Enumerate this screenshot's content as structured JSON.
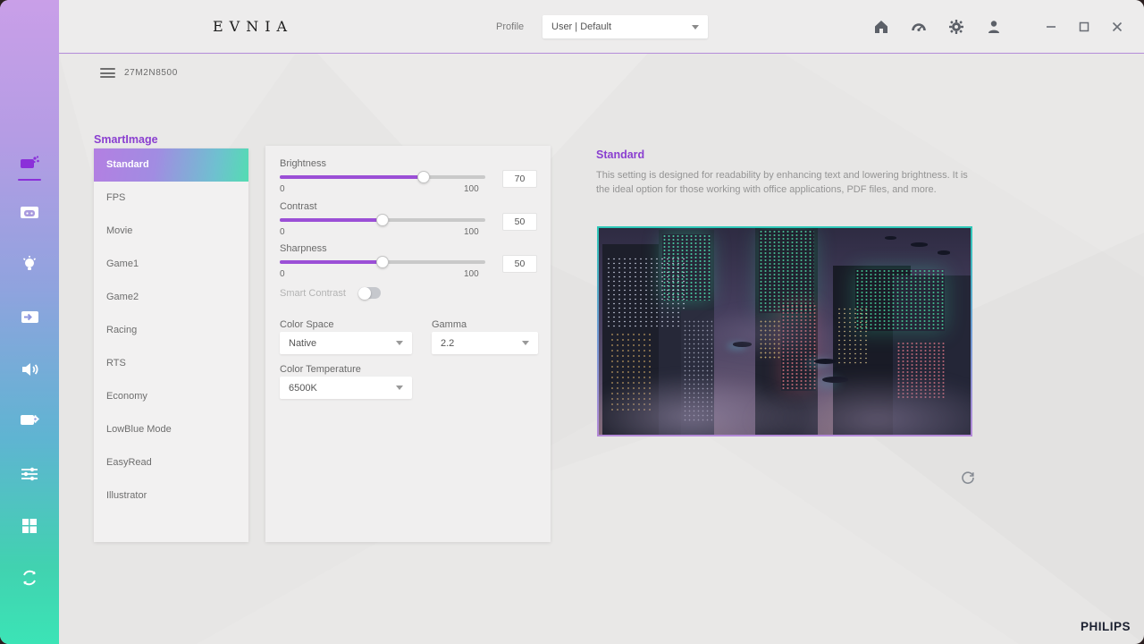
{
  "brand": {
    "logo": "EVNIA",
    "philips": "PHILIPS"
  },
  "header": {
    "profile_label": "Profile",
    "profile_value": "User | Default",
    "icons": [
      "home-icon",
      "dashboard-icon",
      "settings-icon",
      "user-icon"
    ],
    "window_controls": [
      "minimize-icon",
      "maximize-icon",
      "close-icon"
    ]
  },
  "monitor": {
    "name": "27M2N8500"
  },
  "sidebar": {
    "icons": [
      "smartimage-icon",
      "game-mode-icon",
      "lighting-icon",
      "input-source-icon",
      "audio-icon",
      "system-settings-icon",
      "adjustments-icon",
      "layout-icon",
      "sync-icon"
    ],
    "active": "smartimage-icon"
  },
  "smartimage": {
    "title": "SmartImage",
    "selected": "Standard",
    "modes": [
      "Standard",
      "FPS",
      "Movie",
      "Game1",
      "Game2",
      "Racing",
      "RTS",
      "Economy",
      "LowBlue Mode",
      "EasyRead",
      "Illustrator"
    ]
  },
  "settings": {
    "sliders": [
      {
        "label": "Brightness",
        "min": "0",
        "max": "100",
        "value": "70",
        "percent": 70
      },
      {
        "label": "Contrast",
        "min": "0",
        "max": "100",
        "value": "50",
        "percent": 50
      },
      {
        "label": "Sharpness",
        "min": "0",
        "max": "100",
        "value": "50",
        "percent": 50
      }
    ],
    "smart_contrast": {
      "label": "Smart Contrast",
      "enabled": false
    },
    "dropdowns": [
      {
        "label": "Color Space",
        "value": "Native"
      },
      {
        "label": "Gamma",
        "value": "2.2"
      },
      {
        "label": "Color Temperature",
        "value": "6500K"
      }
    ]
  },
  "detail": {
    "title": "Standard",
    "description": "This setting is designed for readability by enhancing text and lowering brightness. It is the ideal option for those working with office applications, PDF files, and more."
  },
  "colors": {
    "accent_purple": "#9b4fd6",
    "accent_teal": "#3fd9ae",
    "header_line": "#b48cd9",
    "selected_gradient": [
      "#b37fe2",
      "#54dcb2"
    ],
    "sidebar_gradient": [
      "#c99fe8",
      "#3be4b6"
    ]
  }
}
